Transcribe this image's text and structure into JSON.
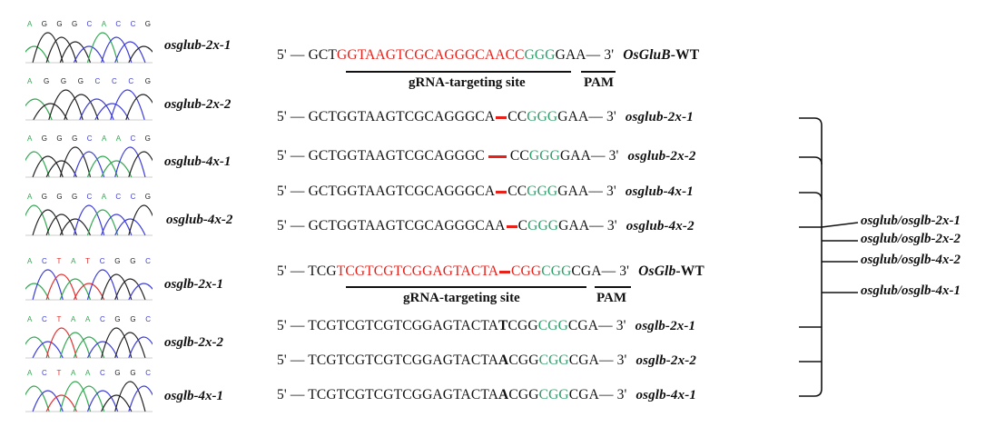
{
  "traces": [
    {
      "label": "osglub-2x-1",
      "bases": [
        "A",
        "G",
        "G",
        "G",
        "C",
        "A",
        "C",
        "C",
        "G"
      ]
    },
    {
      "label": "osglub-2x-2",
      "bases": [
        "A",
        "G",
        "G",
        "G",
        "C",
        "C",
        "C",
        "G"
      ]
    },
    {
      "label": "osglub-4x-1",
      "bases": [
        "A",
        "G",
        "G",
        "G",
        "C",
        "A",
        "A",
        "C",
        "G"
      ]
    },
    {
      "label": "osglub-4x-2",
      "bases": [
        "A",
        "G",
        "G",
        "G",
        "C",
        "A",
        "C",
        "C",
        "G"
      ]
    },
    {
      "label": "osglb-2x-1",
      "bases": [
        "A",
        "C",
        "T",
        "A",
        "T",
        "C",
        "G",
        "G",
        "C"
      ]
    },
    {
      "label": "osglb-2x-2",
      "bases": [
        "A",
        "C",
        "T",
        "A",
        "A",
        "C",
        "G",
        "G",
        "C"
      ]
    },
    {
      "label": "osglb-4x-1",
      "bases": [
        "A",
        "C",
        "T",
        "A",
        "A",
        "C",
        "G",
        "G",
        "C"
      ]
    }
  ],
  "base_colors": {
    "A": "#2fa84f",
    "C": "#3b3bd9",
    "G": "#222222",
    "T": "#e03030"
  },
  "gluB": {
    "wt": {
      "five": "5' —",
      "pre": "GCT",
      "target": "GGTAAGTCGCAGGGCAACC",
      "pam": "GGG",
      "post": "GAA",
      "three": "— 3'",
      "name_italic": "OsGluB",
      "name_suffix": "-WT"
    },
    "grna_label": "gRNA-targeting site",
    "pam_label": "PAM",
    "mutants": [
      {
        "five": "5' —",
        "a": "GCTGGTAAGTCGCAGGGCA",
        "b": "CC",
        "pam": "GGG",
        "post": "GAA",
        "three": "— 3'",
        "name": "osglub-2x-1"
      },
      {
        "five": "5' —",
        "a": "GCTGGTAAGTCGCAGGGC",
        "b": "CC",
        "pam": "GGG",
        "post": "GAA",
        "three": "— 3'",
        "name": "osglub-2x-2"
      },
      {
        "five": "5' —",
        "a": "GCTGGTAAGTCGCAGGGCA",
        "b": "CC",
        "pam": "GGG",
        "post": "GAA",
        "three": "— 3'",
        "name": "osglub-4x-1"
      },
      {
        "five": "5' —",
        "a": "GCTGGTAAGTCGCAGGGCAA",
        "b": "C",
        "pam": "GGG",
        "post": "GAA",
        "three": "— 3'",
        "name": "osglub-4x-2"
      }
    ]
  },
  "glb": {
    "wt": {
      "five": "5' —",
      "pre": "TCG",
      "target_a": "TCGTCGTCGGAGTACTA",
      "target_b": "CGG",
      "pam": "CGG",
      "post": "CGA",
      "three": "— 3'",
      "name_italic": "OsGlb",
      "name_suffix": "-WT"
    },
    "grna_label": "gRNA-targeting site",
    "pam_label": "PAM",
    "mutants": [
      {
        "five": "5' —",
        "a": "TCGTCGTCGTCGGAGTACTA",
        "ins": "T",
        "b": "CGG",
        "pam": "CGG",
        "post": "CGA",
        "three": "— 3'",
        "name": "osglb-2x-1"
      },
      {
        "five": "5' —",
        "a": "TCGTCGTCGTCGGAGTACTA",
        "ins": "A",
        "b": "CGG",
        "pam": "CGG",
        "post": "CGA",
        "three": "— 3'",
        "name": "osglb-2x-2"
      },
      {
        "five": "5' —",
        "a": "TCGTCGTCGTCGGAGTACTA",
        "ins": "A",
        "b": "CGG",
        "pam": "CGG",
        "post": "CGA",
        "three": "— 3'",
        "name": "osglb-4x-1"
      }
    ]
  },
  "double_mutants": [
    "osglub/osglb-2x-1",
    "osglub/osglb-2x-2",
    "osglub/osglb-4x-2",
    "osglub/osglb-4x-1"
  ]
}
